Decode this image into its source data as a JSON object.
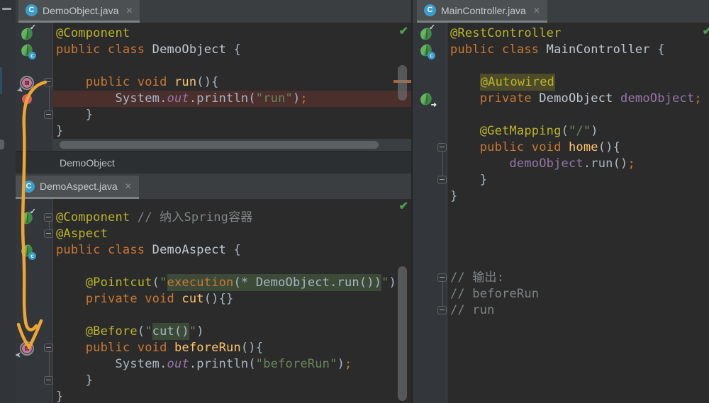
{
  "glyphs": {
    "inspections_ok": "✔"
  },
  "annotation": {
    "type": "hand-drawn-arrow",
    "color": "#f0a532"
  },
  "panes": {
    "demo_object": {
      "tab": {
        "icon_letter": "C",
        "label": "DemoObject.java",
        "close_glyph": "✕"
      },
      "breadcrumb": "DemoObject",
      "lines": [
        {
          "icons": [
            "spring-bean-check-icon"
          ],
          "tokens": [
            [
              "ann",
              "@Component"
            ]
          ]
        },
        {
          "icons": [
            "spring-bean-class-icon"
          ],
          "tokens": [
            [
              "kw",
              "public class "
            ],
            [
              "decl",
              "DemoObject "
            ],
            [
              "pl",
              "{"
            ]
          ]
        },
        {
          "tokens": []
        },
        {
          "icons": [
            "aop-advice-icon"
          ],
          "fold": "open",
          "tokens": [
            [
              "pl",
              "    "
            ],
            [
              "kw",
              "public void "
            ],
            [
              "meth",
              "run"
            ],
            [
              "pl",
              "(){"
            ]
          ]
        },
        {
          "icons": [
            "breakpoint-check-icon"
          ],
          "line_highlight": "debug-red",
          "tokens": [
            [
              "pl",
              "        System."
            ],
            [
              "fieldi",
              "out"
            ],
            [
              "pl",
              ".println("
            ],
            [
              "str",
              "\"run\""
            ],
            [
              "pl",
              ")"
            ],
            [
              "semi",
              ";"
            ]
          ]
        },
        {
          "fold": "close",
          "tokens": [
            [
              "pl",
              "    }"
            ]
          ]
        },
        {
          "tokens": [
            [
              "pl",
              "}"
            ]
          ]
        }
      ]
    },
    "demo_aspect": {
      "tab": {
        "icon_letter": "C",
        "label": "DemoAspect.java",
        "close_glyph": "✕"
      },
      "lines": [
        {
          "icons": [
            "spring-bean-check-icon"
          ],
          "fold": "open",
          "tokens": [
            [
              "ann",
              "@Component "
            ],
            [
              "cmt",
              "// 纳入Spring容器"
            ]
          ]
        },
        {
          "fold": "close",
          "tokens": [
            [
              "ann",
              "@Aspect"
            ]
          ]
        },
        {
          "icons": [
            "spring-bean-class-icon"
          ],
          "tokens": [
            [
              "kw",
              "public class "
            ],
            [
              "decl",
              "DemoAspect "
            ],
            [
              "pl",
              "{"
            ]
          ]
        },
        {
          "tokens": []
        },
        {
          "tokens": [
            [
              "pl",
              "    "
            ],
            [
              "ann",
              "@Pointcut"
            ],
            [
              "pl",
              "("
            ],
            [
              "str",
              "\""
            ],
            [
              "kw hlg",
              "execution"
            ],
            [
              "pl hlg",
              "(* DemoObject.run())"
            ],
            [
              "str",
              "\""
            ],
            [
              "pl",
              ")"
            ]
          ]
        },
        {
          "tokens": [
            [
              "pl",
              "    "
            ],
            [
              "kw",
              "private void "
            ],
            [
              "meth",
              "cut"
            ],
            [
              "pl",
              "(){}"
            ]
          ]
        },
        {
          "tokens": []
        },
        {
          "tokens": [
            [
              "pl",
              "    "
            ],
            [
              "ann",
              "@Before"
            ],
            [
              "pl",
              "("
            ],
            [
              "str",
              "\""
            ],
            [
              "pl hlg",
              "cut()"
            ],
            [
              "str",
              "\""
            ],
            [
              "pl",
              ")"
            ]
          ]
        },
        {
          "icons": [
            "aop-advice-icon-left"
          ],
          "fold": "open",
          "tokens": [
            [
              "pl",
              "    "
            ],
            [
              "kw",
              "public void "
            ],
            [
              "meth",
              "beforeRun"
            ],
            [
              "pl",
              "(){"
            ]
          ]
        },
        {
          "tokens": [
            [
              "pl",
              "        System."
            ],
            [
              "fieldi",
              "out"
            ],
            [
              "pl",
              ".println("
            ],
            [
              "str",
              "\"beforeRun\""
            ],
            [
              "pl",
              ")"
            ],
            [
              "semi",
              ";"
            ]
          ]
        },
        {
          "fold": "close",
          "tokens": [
            [
              "pl",
              "    }"
            ]
          ]
        },
        {
          "tokens": [
            [
              "pl",
              "}"
            ]
          ]
        }
      ]
    },
    "main_controller": {
      "tab": {
        "icon_letter": "C",
        "label": "MainController.java",
        "close_glyph": "✕"
      },
      "lines": [
        {
          "icons": [
            "spring-bean-check-icon"
          ],
          "tokens": [
            [
              "ann",
              "@RestController"
            ]
          ]
        },
        {
          "icons": [
            "spring-bean-class-icon"
          ],
          "tokens": [
            [
              "kw",
              "public class "
            ],
            [
              "decl",
              "MainController "
            ],
            [
              "pl",
              "{"
            ]
          ]
        },
        {
          "tokens": []
        },
        {
          "tokens": [
            [
              "pl",
              "    "
            ],
            [
              "ann hlo",
              "@Autowired"
            ]
          ]
        },
        {
          "icons": [
            "spring-bean-arrow-icon"
          ],
          "tokens": [
            [
              "pl",
              "    "
            ],
            [
              "kw",
              "private "
            ],
            [
              "decl",
              "DemoObject "
            ],
            [
              "field",
              "demoObject"
            ],
            [
              "semi",
              ";"
            ]
          ]
        },
        {
          "tokens": []
        },
        {
          "tokens": [
            [
              "pl",
              "    "
            ],
            [
              "ann",
              "@GetMapping"
            ],
            [
              "pl",
              "("
            ],
            [
              "str",
              "\"/\""
            ],
            [
              "pl",
              ")"
            ]
          ]
        },
        {
          "fold": "open",
          "tokens": [
            [
              "pl",
              "    "
            ],
            [
              "kw",
              "public void "
            ],
            [
              "meth",
              "home"
            ],
            [
              "pl",
              "(){"
            ]
          ]
        },
        {
          "tokens": [
            [
              "pl",
              "        "
            ],
            [
              "field",
              "demoObject"
            ],
            [
              "pl",
              ".run()"
            ],
            [
              "semi",
              ";"
            ]
          ]
        },
        {
          "fold": "close",
          "tokens": [
            [
              "pl",
              "    }"
            ]
          ]
        },
        {
          "tokens": [
            [
              "pl",
              "}"
            ]
          ]
        },
        {
          "tokens": []
        },
        {
          "tokens": []
        },
        {
          "tokens": []
        },
        {
          "tokens": []
        },
        {
          "fold": "open",
          "tokens": [
            [
              "cmt",
              "// 输出:"
            ]
          ]
        },
        {
          "tokens": [
            [
              "cmt",
              "// beforeRun"
            ]
          ]
        },
        {
          "fold": "close",
          "tokens": [
            [
              "cmt",
              "// run"
            ]
          ]
        }
      ]
    }
  }
}
